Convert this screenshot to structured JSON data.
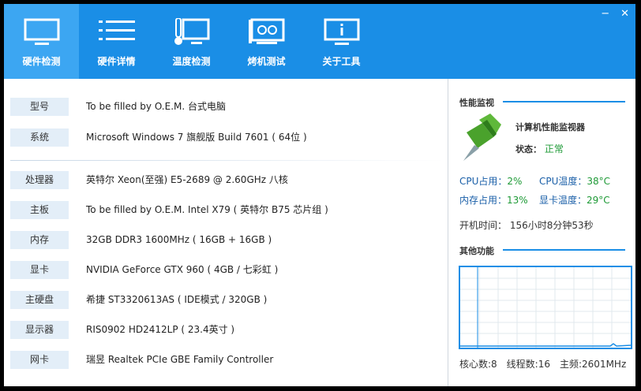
{
  "window": {
    "controls": {
      "minimize": "−",
      "close": "✕"
    }
  },
  "tabs": [
    {
      "label": "硬件检测",
      "icon": "monitor-icon",
      "active": true
    },
    {
      "label": "硬件详情",
      "icon": "list-icon",
      "active": false
    },
    {
      "label": "温度检测",
      "icon": "thermometer-icon",
      "active": false
    },
    {
      "label": "烤机测试",
      "icon": "graphics-card-icon",
      "active": false
    },
    {
      "label": "关于工具",
      "icon": "info-icon",
      "active": false
    }
  ],
  "hardware": [
    {
      "key": "型号",
      "value": "To be filled by O.E.M. 台式电脑"
    },
    {
      "key": "系统",
      "value": "Microsoft Windows 7 旗舰版 Build 7601 ( 64位 )"
    },
    {
      "key": "处理器",
      "value": "英特尔 Xeon(至强) E5-2689 @ 2.60GHz 八核"
    },
    {
      "key": "主板",
      "value": "To be filled by O.E.M. Intel X79 ( 英特尔 B75 芯片组 )"
    },
    {
      "key": "内存",
      "value": "32GB DDR3 1600MHz ( 16GB + 16GB )"
    },
    {
      "key": "显卡",
      "value": "NVIDIA GeForce GTX 960 ( 4GB / 七彩虹 )"
    },
    {
      "key": "主硬盘",
      "value": "希捷 ST3320613AS ( IDE模式 / 320GB )"
    },
    {
      "key": "显示器",
      "value": "RIS0902 HD2412LP ( 23.4英寸 )"
    },
    {
      "key": "网卡",
      "value": "瑞昱 Realtek PCIe GBE Family Controller"
    }
  ],
  "monitor": {
    "section_title": "性能监视",
    "title": "计算机性能监视器",
    "status_label": "状态：",
    "status_value": "正常",
    "cpu_usage_label": "CPU占用：",
    "cpu_usage": "2%",
    "cpu_temp_label": "CPU温度：",
    "cpu_temp": "38°C",
    "mem_usage_label": "内存占用：",
    "mem_usage": "13%",
    "gpu_temp_label": "显卡温度：",
    "gpu_temp": "29°C",
    "uptime": "开机时间： 156小时8分钟53秒"
  },
  "other": {
    "section_title": "其他功能",
    "bottom": "核心数:8　线程数:16　主频:2601MHz"
  },
  "colors": {
    "accent": "#1a8ee6",
    "active_tab": "#3ca6f2",
    "ok": "#1e9a36"
  }
}
